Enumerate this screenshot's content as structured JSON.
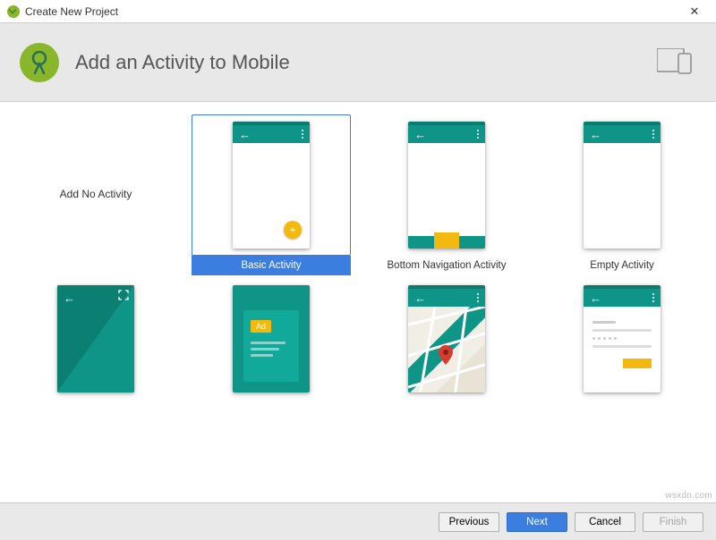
{
  "window": {
    "title": "Create New Project"
  },
  "header": {
    "title": "Add an Activity to Mobile"
  },
  "cards": {
    "add_no_activity": "Add No Activity",
    "basic_activity": "Basic Activity",
    "bottom_nav_activity": "Bottom Navigation Activity",
    "empty_activity": "Empty Activity",
    "ad_label": "Ad"
  },
  "selected": "basic_activity",
  "footer": {
    "previous": "Previous",
    "next": "Next",
    "cancel": "Cancel",
    "finish": "Finish"
  },
  "watermark": "wsxdn.com"
}
